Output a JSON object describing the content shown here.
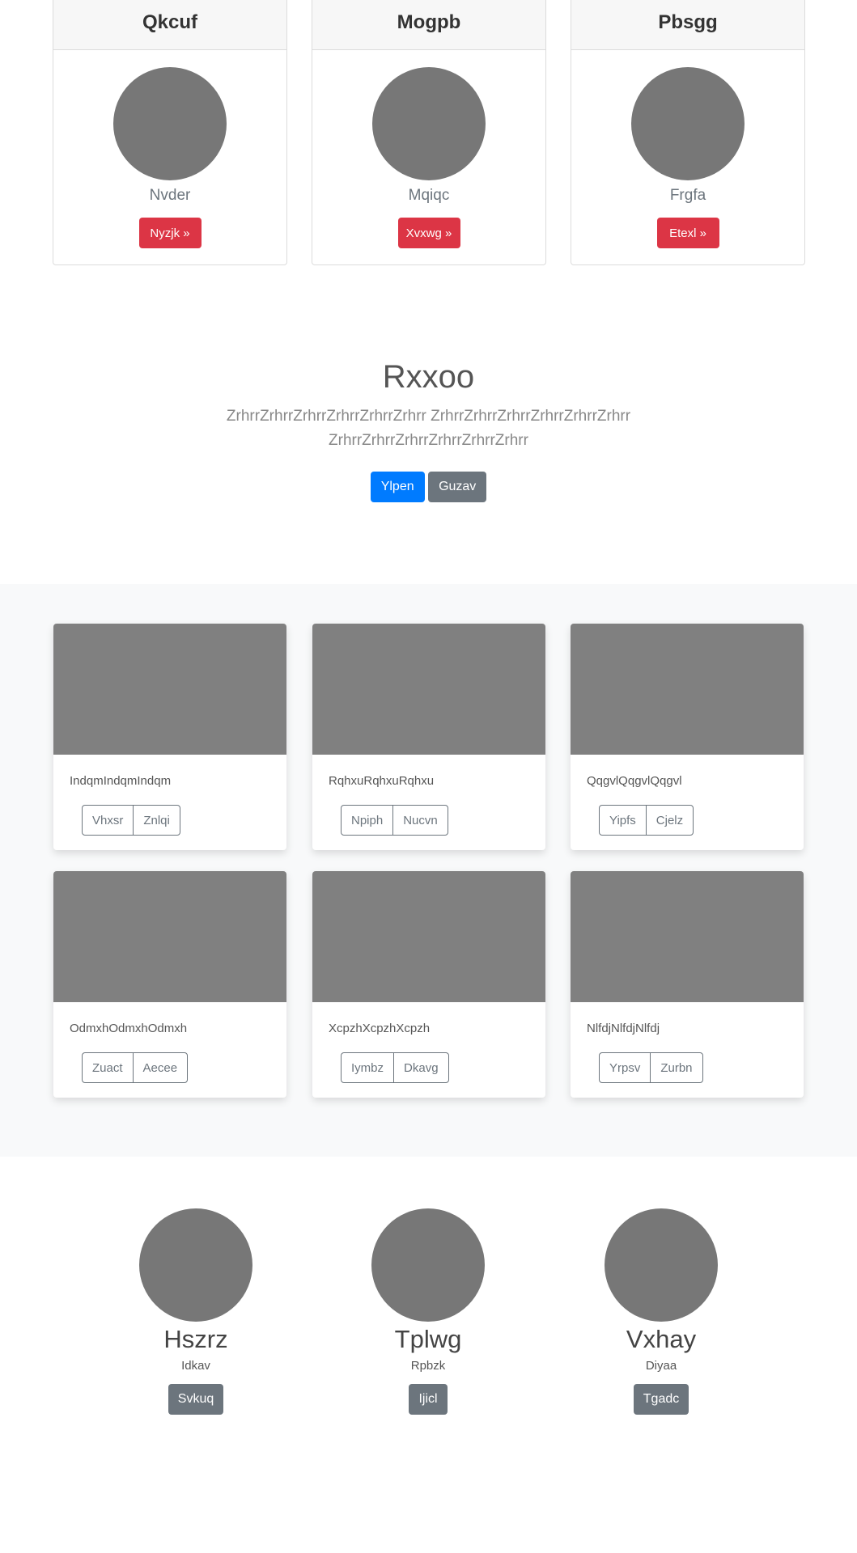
{
  "top_cards": [
    {
      "title": "Qkcuf",
      "subtitle": "Nvder",
      "button": "Nyzjk »"
    },
    {
      "title": "Mogpb",
      "subtitle": "Mqiqc",
      "button": "Xvxwg »"
    },
    {
      "title": "Pbsgg",
      "subtitle": "Frgfa",
      "button": "Etexl »"
    }
  ],
  "jumbotron": {
    "heading": "Rxxoo",
    "lead": "ZrhrrZrhrrZrhrrZrhrrZrhrrZrhrr ZrhrrZrhrrZrhrrZrhrrZrhrrZrhrr ZrhrrZrhrrZrhrrZrhrrZrhrrZrhrr",
    "primary_button": "Ylpen",
    "secondary_button": "Guzav"
  },
  "album": [
    {
      "text": "IndqmIndqmIndqm",
      "buttons": [
        "Vhxsr",
        "Znlqi"
      ]
    },
    {
      "text": "RqhxuRqhxuRqhxu",
      "buttons": [
        "Npiph",
        "Nucvn"
      ]
    },
    {
      "text": "QqgvlQqgvlQqgvl",
      "buttons": [
        "Yipfs",
        "Cjelz"
      ]
    },
    {
      "text": "OdmxhOdmxhOdmxh",
      "buttons": [
        "Zuact",
        "Aecee"
      ]
    },
    {
      "text": "XcpzhXcpzhXcpzh",
      "buttons": [
        "Iymbz",
        "Dkavg"
      ]
    },
    {
      "text": "NlfdjNlfdjNlfdj",
      "buttons": [
        "Yrpsv",
        "Zurbn"
      ]
    }
  ],
  "team": [
    {
      "name": "Hszrz",
      "role": "Idkav",
      "button": "Svkuq"
    },
    {
      "name": "Tplwg",
      "role": "Rpbzk",
      "button": "Ijicl"
    },
    {
      "name": "Vxhay",
      "role": "Diyaa",
      "button": "Tgadc"
    }
  ],
  "colors": {
    "danger": "#dc3545",
    "primary": "#007bff",
    "secondary": "#6c757d",
    "placeholder": "#777777",
    "album_bg": "#f8f9fa"
  }
}
